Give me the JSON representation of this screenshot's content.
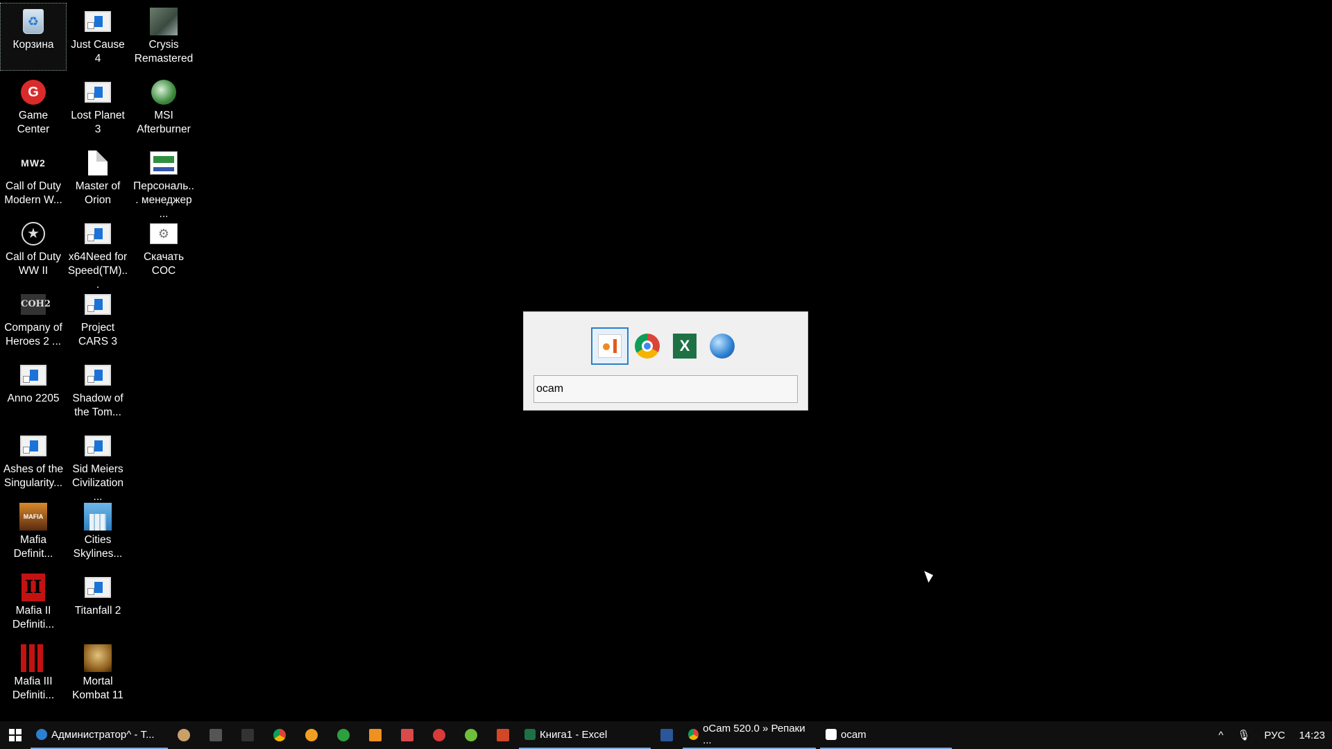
{
  "desktop": {
    "icons": [
      {
        "label": "Корзина",
        "icon": "recycle-bin-icon"
      },
      {
        "label": "Just Cause 4",
        "icon": "shortcut-icon"
      },
      {
        "label": "Crysis Remastered",
        "icon": "crysis-icon"
      },
      {
        "label": "Game Center",
        "icon": "game-center-icon",
        "glyph": "G"
      },
      {
        "label": "Lost Planet 3",
        "icon": "shortcut-icon"
      },
      {
        "label": "MSI Afterburner",
        "icon": "msi-afterburner-icon"
      },
      {
        "label": "Call of Duty Modern W...",
        "icon": "mw2-icon",
        "glyph": "MW2"
      },
      {
        "label": "Master of Orion",
        "icon": "document-icon"
      },
      {
        "label": "Персональ... менеджер ...",
        "icon": "personal-manager-icon"
      },
      {
        "label": "Call of Duty WW II",
        "icon": "star-icon",
        "glyph": "★"
      },
      {
        "label": "x64Need for Speed(TM)...",
        "icon": "shortcut-icon"
      },
      {
        "label": "Скачать COC",
        "icon": "gear-icon",
        "glyph": "⚙"
      },
      {
        "label": "Company of Heroes 2 ...",
        "icon": "coh2-icon",
        "glyph": "COH2"
      },
      {
        "label": "Project CARS 3",
        "icon": "shortcut-icon"
      },
      {
        "label": "Anno 2205",
        "icon": "shortcut-icon"
      },
      {
        "label": "Shadow of the Tom...",
        "icon": "shortcut-icon"
      },
      {
        "label": "Ashes of the Singularity...",
        "icon": "shortcut-icon"
      },
      {
        "label": "Sid Meiers Civilization ...",
        "icon": "shortcut-icon"
      },
      {
        "label": "Mafia Definit...",
        "icon": "mafia-icon",
        "glyph": "MAFIA"
      },
      {
        "label": "Cities Skylines...",
        "icon": "cities-skylines-icon"
      },
      {
        "label": "Mafia II Definiti...",
        "icon": "mafia-ii-icon",
        "glyph": "II"
      },
      {
        "label": "Titanfall 2",
        "icon": "shortcut-icon"
      },
      {
        "label": "Mafia III Definiti...",
        "icon": "mafia-iii-icon"
      },
      {
        "label": "Mortal Kombat 11",
        "icon": "mortal-kombat-icon"
      }
    ]
  },
  "switcher": {
    "apps": [
      "ocam-icon",
      "chrome-icon",
      "excel-icon",
      "globe-icon"
    ],
    "excel_glyph": "X",
    "query": "ocam"
  },
  "taskbar": {
    "tasks": [
      {
        "label": "Администратор^ - T...",
        "icon": "globe-icon"
      },
      {
        "label": "Книга1 - Excel",
        "icon": "excel-icon"
      },
      {
        "label": "oCam 520.0 » Репаки ...",
        "icon": "chrome-icon"
      },
      {
        "label": "ocam",
        "icon": "ocam-icon"
      }
    ],
    "tray": {
      "language": "РУС",
      "time": "14:23"
    }
  },
  "colors": {
    "desktop_bg": "#000000",
    "taskbar_bg": "#101010",
    "switcher_bg": "#f0f0f0",
    "accent": "#2a7fc6"
  }
}
